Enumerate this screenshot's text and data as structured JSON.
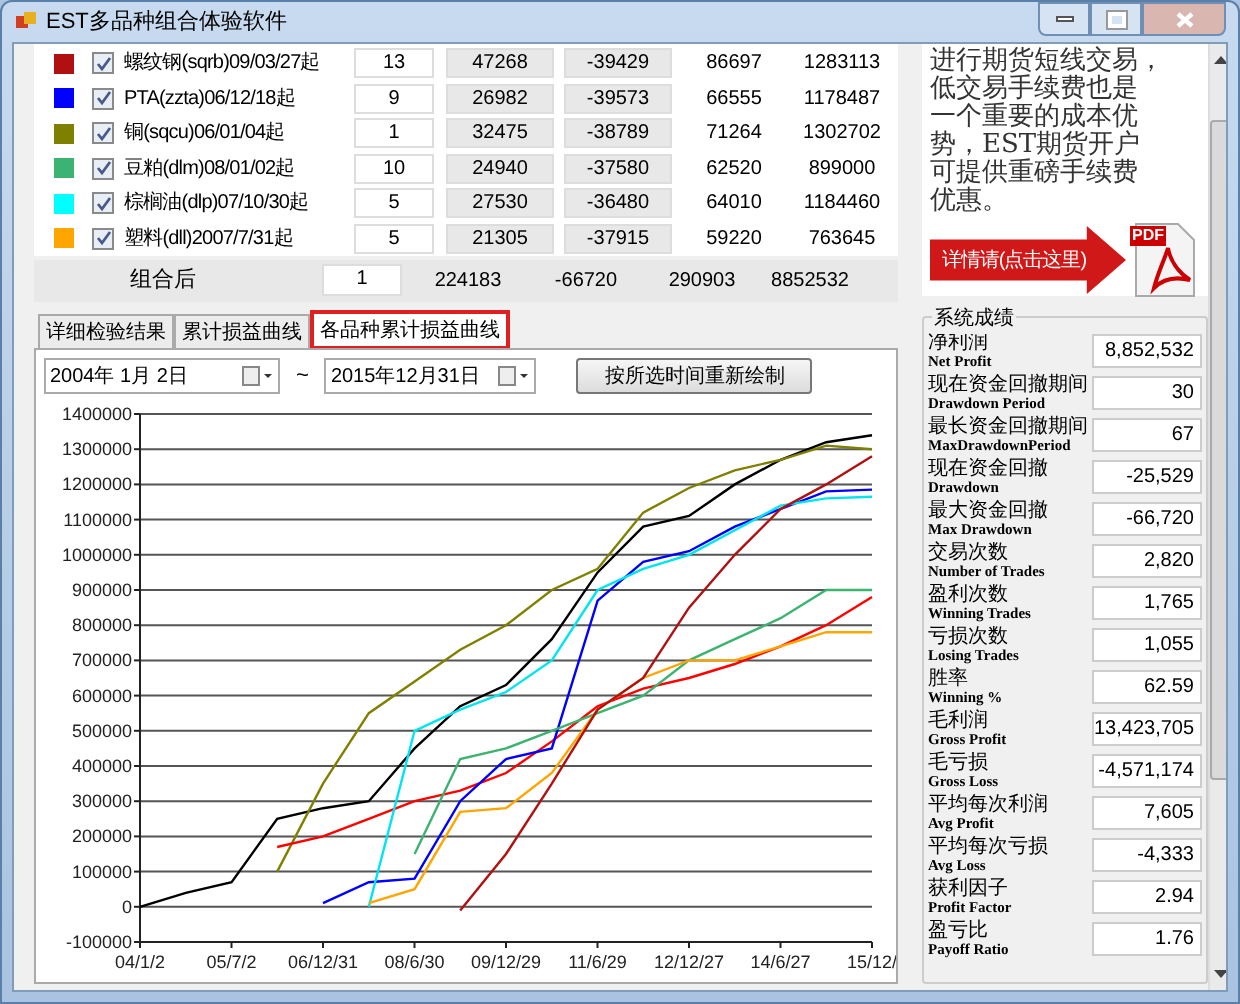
{
  "window": {
    "title": "EST多品种组合体验软件"
  },
  "table": {
    "rows": [
      {
        "color": "#b01010",
        "checked": true,
        "name": "螺纹钢(sqrb)09/03/27起",
        "col_3": "13",
        "col_4": "47268",
        "col_5": "-39429",
        "col_6": "86697",
        "col_7": "1283113"
      },
      {
        "color": "#0000ff",
        "checked": true,
        "name": "PTA(zzta)06/12/18起",
        "col_3": "9",
        "col_4": "26982",
        "col_5": "-39573",
        "col_6": "66555",
        "col_7": "1178487"
      },
      {
        "color": "#808000",
        "checked": true,
        "name": "铜(sqcu)06/01/04起",
        "col_3": "1",
        "col_4": "32475",
        "col_5": "-38789",
        "col_6": "71264",
        "col_7": "1302702"
      },
      {
        "color": "#3cb371",
        "checked": true,
        "name": "豆粕(dlm)08/01/02起",
        "col_3": "10",
        "col_4": "24940",
        "col_5": "-37580",
        "col_6": "62520",
        "col_7": "899000"
      },
      {
        "color": "#00ffff",
        "checked": true,
        "name": "棕榈油(dlp)07/10/30起",
        "col_3": "5",
        "col_4": "27530",
        "col_5": "-36480",
        "col_6": "64010",
        "col_7": "1184460"
      },
      {
        "color": "#ffa500",
        "checked": true,
        "name": "塑料(dll)2007/7/31起",
        "col_3": "5",
        "col_4": "21305",
        "col_5": "-37915",
        "col_6": "59220",
        "col_7": "763645"
      }
    ],
    "total": {
      "label": "组合后",
      "col_3": "1",
      "col_4": "224183",
      "col_5": "-66720",
      "col_6": "290903",
      "col_7": "8852532"
    }
  },
  "ad": {
    "text_lines": [
      "进行期货短线交易，",
      "低交易手续费也是",
      "一个重要的成本优",
      "势，EST期货开户",
      "可提供重磅手续费",
      "优惠。"
    ],
    "button": "详情请(点击这里)",
    "pdf_label": "PDF"
  },
  "tabs": [
    {
      "label": "详细检验结果",
      "selected": false
    },
    {
      "label": "累计损益曲线",
      "selected": false
    },
    {
      "label": "各品种累计损益曲线",
      "selected": true
    }
  ],
  "date_range": {
    "from": "2004年 1月 2日",
    "separator": "~",
    "to": "2015年12月31日"
  },
  "redraw_button": "按所选时间重新绘制",
  "chart_data": {
    "type": "line",
    "grid": true,
    "categories": [
      "04/1/2",
      null,
      "05/7/2",
      null,
      "06/12/31",
      null,
      "08/6/30",
      null,
      "09/12/29",
      null,
      "11/6/29",
      null,
      "12/12/27",
      null,
      "14/6/27",
      null,
      "15/12/"
    ],
    "ylim": [
      -100000,
      1400000
    ],
    "yticks": [
      -100000,
      0,
      100000,
      200000,
      300000,
      400000,
      500000,
      600000,
      700000,
      800000,
      900000,
      1000000,
      1100000,
      1200000,
      1300000,
      1400000
    ],
    "series": [
      {
        "color": "#000000",
        "values": [
          0,
          40000,
          70000,
          250000,
          280000,
          300000,
          450000,
          570000,
          630000,
          760000,
          950000,
          1080000,
          1110000,
          1200000,
          1270000,
          1320000,
          1340000
        ]
      },
      {
        "color": "#808000",
        "values": [
          null,
          null,
          null,
          100000,
          350000,
          550000,
          640000,
          730000,
          800000,
          900000,
          960000,
          1120000,
          1190000,
          1240000,
          1270000,
          1310000,
          1300000
        ]
      },
      {
        "color": "#ff0000",
        "values": [
          null,
          null,
          null,
          170000,
          200000,
          250000,
          300000,
          330000,
          380000,
          470000,
          570000,
          620000,
          650000,
          690000,
          740000,
          800000,
          880000
        ]
      },
      {
        "color": "#0000ff",
        "values": [
          null,
          null,
          null,
          null,
          10000,
          70000,
          80000,
          300000,
          420000,
          450000,
          870000,
          980000,
          1010000,
          1080000,
          1130000,
          1180000,
          1185000
        ]
      },
      {
        "color": "#3cb371",
        "values": [
          null,
          null,
          null,
          null,
          null,
          null,
          150000,
          420000,
          450000,
          500000,
          550000,
          600000,
          700000,
          760000,
          820000,
          900000,
          900000
        ]
      },
      {
        "color": "#00e5ee",
        "values": [
          null,
          null,
          null,
          null,
          null,
          0,
          500000,
          560000,
          610000,
          700000,
          900000,
          960000,
          1000000,
          1070000,
          1140000,
          1160000,
          1165000
        ]
      },
      {
        "color": "#ffa500",
        "values": [
          null,
          null,
          null,
          null,
          null,
          10000,
          50000,
          270000,
          280000,
          380000,
          560000,
          650000,
          700000,
          700000,
          740000,
          780000,
          780000
        ]
      },
      {
        "color": "#b01010",
        "values": [
          null,
          null,
          null,
          null,
          null,
          null,
          null,
          -10000,
          150000,
          350000,
          560000,
          650000,
          850000,
          1000000,
          1130000,
          1200000,
          1280000
        ]
      }
    ]
  },
  "stats": {
    "title": "系统成绩",
    "items": [
      {
        "label": "净利润",
        "label_en": "Net Profit",
        "value": "8,852,532"
      },
      {
        "label": "现在资金回撤期间",
        "label_en": "Drawdown Period",
        "value": "30"
      },
      {
        "label": "最长资金回撤期间",
        "label_en": "MaxDrawdownPeriod",
        "value": "67"
      },
      {
        "label": "现在资金回撤",
        "label_en": "Drawdown",
        "value": "-25,529"
      },
      {
        "label": "最大资金回撤",
        "label_en": "Max Drawdown",
        "value": "-66,720"
      },
      {
        "label": "交易次数",
        "label_en": "Number of Trades",
        "value": "2,820"
      },
      {
        "label": "盈利次数",
        "label_en": "Winning Trades",
        "value": "1,765"
      },
      {
        "label": "亏损次数",
        "label_en": "Losing Trades",
        "value": "1,055"
      },
      {
        "label": "胜率",
        "label_en": "Winning %",
        "value": "62.59"
      },
      {
        "label": "毛利润",
        "label_en": "Gross Profit",
        "value": "13,423,705"
      },
      {
        "label": "毛亏损",
        "label_en": "Gross Loss",
        "value": "-4,571,174"
      },
      {
        "label": "平均每次利润",
        "label_en": "Avg Profit",
        "value": "7,605"
      },
      {
        "label": "平均每次亏损",
        "label_en": "Avg Loss",
        "value": "-4,333"
      },
      {
        "label": "获利因子",
        "label_en": "Profit Factor",
        "value": "2.94"
      },
      {
        "label": "盈亏比",
        "label_en": "Payoff Ratio",
        "value": "1.76"
      }
    ]
  }
}
